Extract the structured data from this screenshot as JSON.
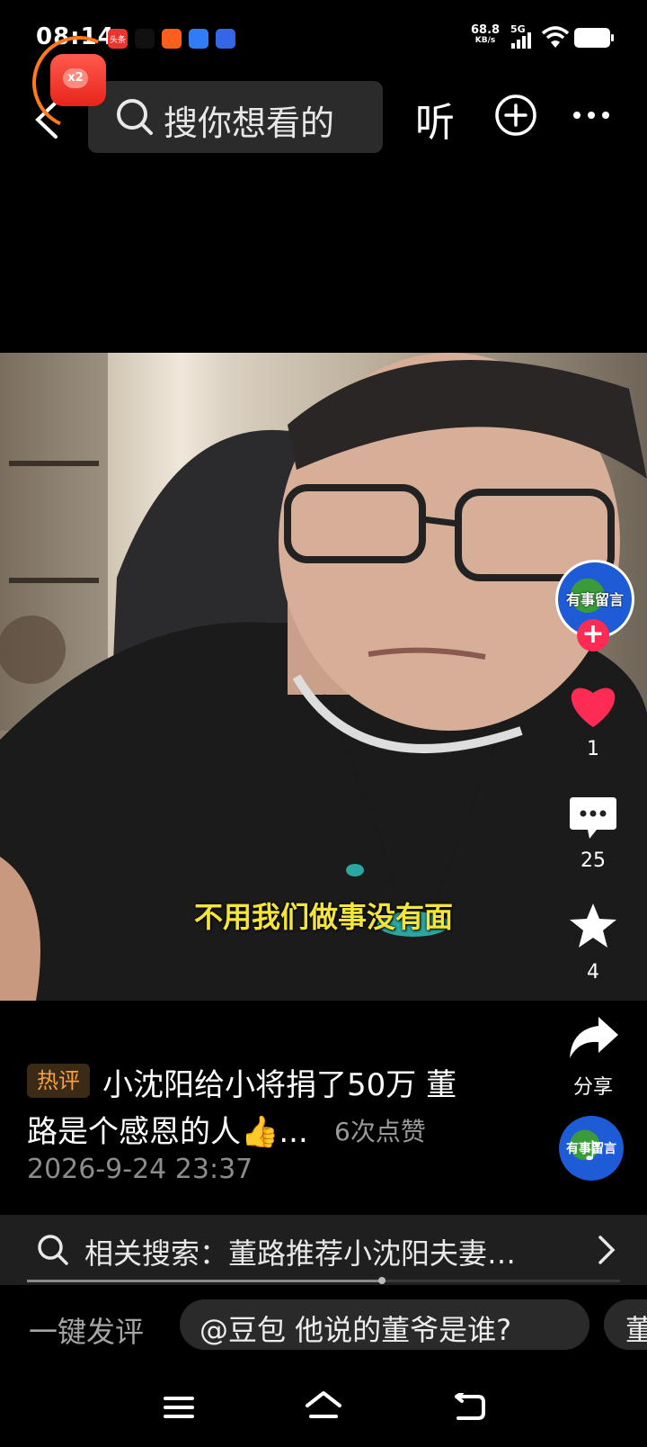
{
  "status_bar": {
    "time": "08:14",
    "net_speed_value": "68.8",
    "net_speed_unit": "KB/s",
    "signal_label": "5G",
    "apps": [
      {
        "name": "toutiao",
        "label": "头条",
        "color": "#e8362f"
      },
      {
        "name": "douyin",
        "label": "",
        "color": "#111111"
      },
      {
        "name": "kuaishou",
        "label": "",
        "color": "#ff5e1f"
      },
      {
        "name": "app-blue",
        "label": "",
        "color": "#2f7cf6"
      },
      {
        "name": "app-blue2",
        "label": "",
        "color": "#3566e8"
      }
    ]
  },
  "top_bar": {
    "search_placeholder": "搜你想看的",
    "listen_label": "听"
  },
  "red_packet": {
    "multiplier": "x2"
  },
  "video": {
    "subtitle": "不用我们做事没有面"
  },
  "side_actions": {
    "author_avatar_text": "有事留言",
    "likes": "1",
    "comments": "25",
    "favorites": "4",
    "share_label": "分享",
    "music_disc_text": "有事留言"
  },
  "caption": {
    "tag": "热评",
    "line1": "小沈阳给小将捐了50万 董",
    "line2": "路是个感恩的人👍...",
    "likes_text": "6次点赞",
    "date": "2026-9-24 23:37"
  },
  "related_search": {
    "text": "相关搜索：董路推荐小沈阳夫妻…",
    "progress": 0.6
  },
  "comment_bar": {
    "quick_comment": "一键发评",
    "chip": "@豆包 他说的董爷是谁?",
    "chip2": "董"
  },
  "colors": {
    "accent_red": "#fe2c55",
    "tag_orange": "#f5a340",
    "subtitle_yellow": "#f5e53a"
  }
}
